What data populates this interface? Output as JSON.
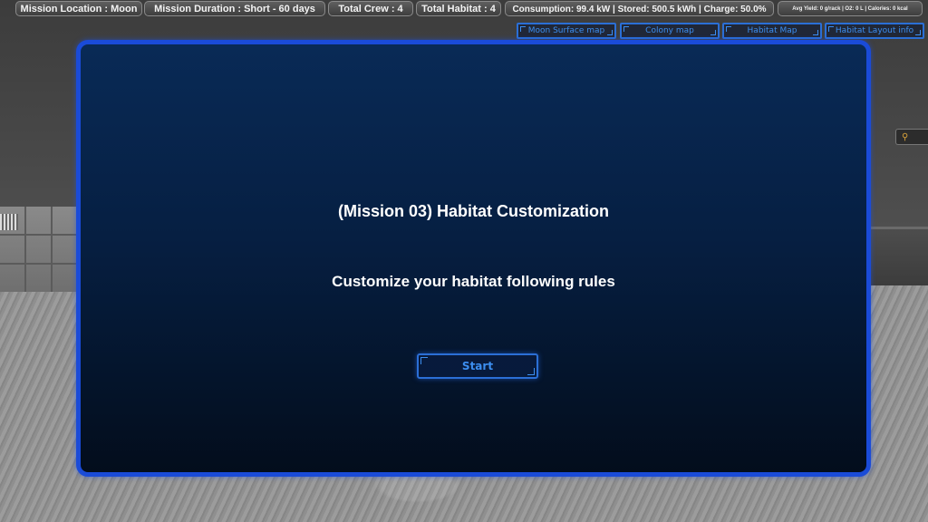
{
  "status_bar": {
    "location": "Mission Location : Moon",
    "duration": "Mission Duration : Short - 60 days",
    "crew": "Total Crew : 4",
    "habitat": "Total Habitat : 4",
    "power": "Consumption: 99.4 kW | Stored: 500.5 kWh | Charge: 50.0%",
    "resources": "Avg Yield: 0 g/rack | O2: 0 L | Calories: 0 kcal"
  },
  "nav": {
    "moon_surface_map": "Moon Surface map",
    "colony_map": "Colony map",
    "habitat_map": "Habitat Map",
    "habitat_layout_info": "Habitat Layout info"
  },
  "modal": {
    "title": "(Mission 03) Habitat Customization",
    "subtitle": "Customize your habitat following rules",
    "start_label": "Start"
  },
  "scene": {
    "side_widget": "⚲"
  },
  "colors": {
    "accent": "#3c8ef0",
    "modal_border": "#1a4bd8",
    "modal_bg": "#061f42"
  }
}
